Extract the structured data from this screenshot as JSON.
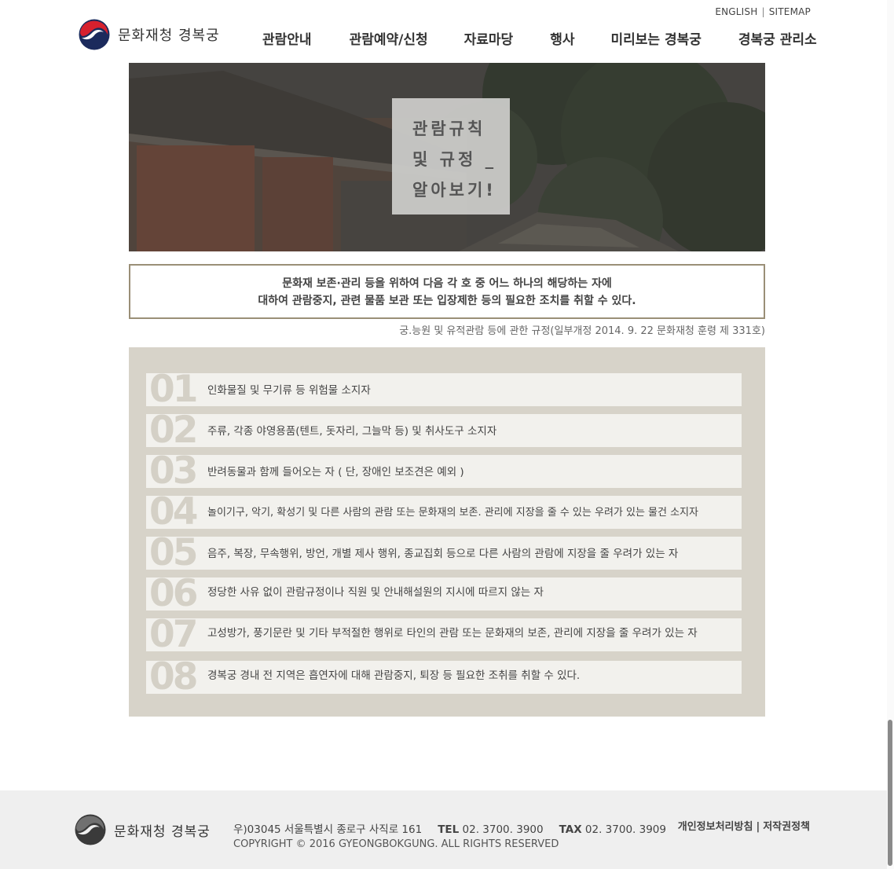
{
  "header": {
    "logo_text": "문화재청 경복궁",
    "util_links": {
      "english": "ENGLISH",
      "separator": "|",
      "sitemap": "SITEMAP"
    },
    "nav": [
      {
        "label": "관람안내"
      },
      {
        "label": "관람예약/신청"
      },
      {
        "label": "자료마당"
      },
      {
        "label": "행사"
      },
      {
        "label": "미리보는 경복궁"
      },
      {
        "label": "경복궁 관리소"
      }
    ]
  },
  "hero": {
    "title_lines": [
      "관람규칙",
      "및 규정 _",
      "알아보기!"
    ]
  },
  "notice": {
    "line1": "문화재 보존·관리 등을 위하여 다음 각 호 중 어느 하나의 해당하는 자에",
    "line2": "대하여 관람중지, 관련 물품 보관 또는 입장제한 등의 필요한 조치를 취할 수 있다.",
    "source": "궁.능원 및 유적관람 등에 관한 규정(일부개정 2014. 9. 22 문화재청 훈령 제 331호)"
  },
  "rules": [
    {
      "num": "01",
      "text": "인화물질 및 무기류 등 위험물 소지자"
    },
    {
      "num": "02",
      "text": "주류, 각종 야영용품(텐트, 돗자리, 그늘막 등) 및 취사도구 소지자"
    },
    {
      "num": "03",
      "text": "반려동물과 함께 들어오는 자 ( 단, 장애인 보조견은 예외 )"
    },
    {
      "num": "04",
      "text": "놀이기구, 악기, 확성기 및 다른 사람의 관람 또는 문화재의 보존. 관리에 지장을 줄 수 있는  우려가 있는 물건 소지자"
    },
    {
      "num": "05",
      "text": "음주, 복장, 무속행위, 방언, 개별 제사 행위, 종교집회 등으로 다른 사람의 관람에 지장을 줄 우려가 있는 자"
    },
    {
      "num": "06",
      "text": "정당한 사유 없이 관람규정이나 직원 및 안내해설원의 지시에 따르지 않는 자"
    },
    {
      "num": "07",
      "text": "고성방가, 풍기문란 및 기타  부적절한 행위로 타인의 관람 또는 문화재의 보존, 관리에 지장을 줄 우려가 있는 자"
    },
    {
      "num": "08",
      "text": "경복궁 경내 전 지역은 흡연자에 대해 관람중지, 퇴장 등 필요한 조취를 취할 수 있다."
    }
  ],
  "footer": {
    "logo_text": "문화재청 경복궁",
    "address": "우)03045 서울특별시 종로구 사직로 161",
    "tel_label": "TEL",
    "tel": "02. 3700. 3900",
    "fax_label": "TAX",
    "fax": "02. 3700. 3909",
    "copyright": "COPYRIGHT © 2016 GYEONGBOKGUNG. ALL RIGHTS RESERVED",
    "privacy_link": "개인정보처리방침",
    "link_separator": "|",
    "copyright_link": "저작권정책"
  },
  "colors": {
    "notice_border": "#9a8f77",
    "rules_background": "#d7d3c9",
    "rule_row_background": "#f2f1ed",
    "rule_number": "#d4d0c6",
    "footer_background": "#efefef"
  }
}
